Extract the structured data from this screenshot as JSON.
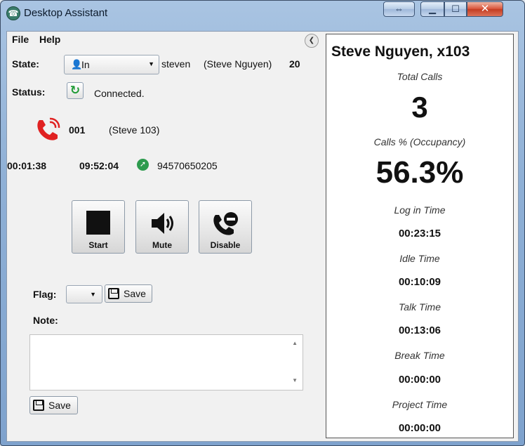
{
  "window": {
    "title": "Desktop Assistant"
  },
  "menu": {
    "file": "File",
    "help": "Help"
  },
  "state": {
    "label": "State:",
    "value": "In",
    "username": "steven",
    "fullname": "(Steve Nguyen)",
    "extension_count": "20"
  },
  "status": {
    "label": "Status:",
    "text": "Connected."
  },
  "call": {
    "line": "001",
    "party": "(Steve 103)",
    "duration": "00:01:38",
    "time": "09:52:04",
    "number": "94570650205"
  },
  "buttons": {
    "start": "Start",
    "mute": "Mute",
    "disable": "Disable"
  },
  "flag": {
    "label": "Flag:",
    "save": "Save"
  },
  "note": {
    "label": "Note:",
    "value": "",
    "save": "Save"
  },
  "stats": {
    "agent": "Steve Nguyen, x103",
    "total_calls_label": "Total Calls",
    "total_calls": "3",
    "occupancy_label": "Calls % (Occupancy)",
    "occupancy": "56.3%",
    "login_label": "Log in Time",
    "login": "00:23:15",
    "idle_label": "Idle Time",
    "idle": "00:10:09",
    "talk_label": "Talk Time",
    "talk": "00:13:06",
    "break_label": "Break Time",
    "break": "00:00:00",
    "project_label": "Project Time",
    "project": "00:00:00"
  },
  "colors": {
    "phone_red": "#e02222",
    "connected_green": "#1e9a35",
    "outbound_green": "#2d9b4e"
  }
}
